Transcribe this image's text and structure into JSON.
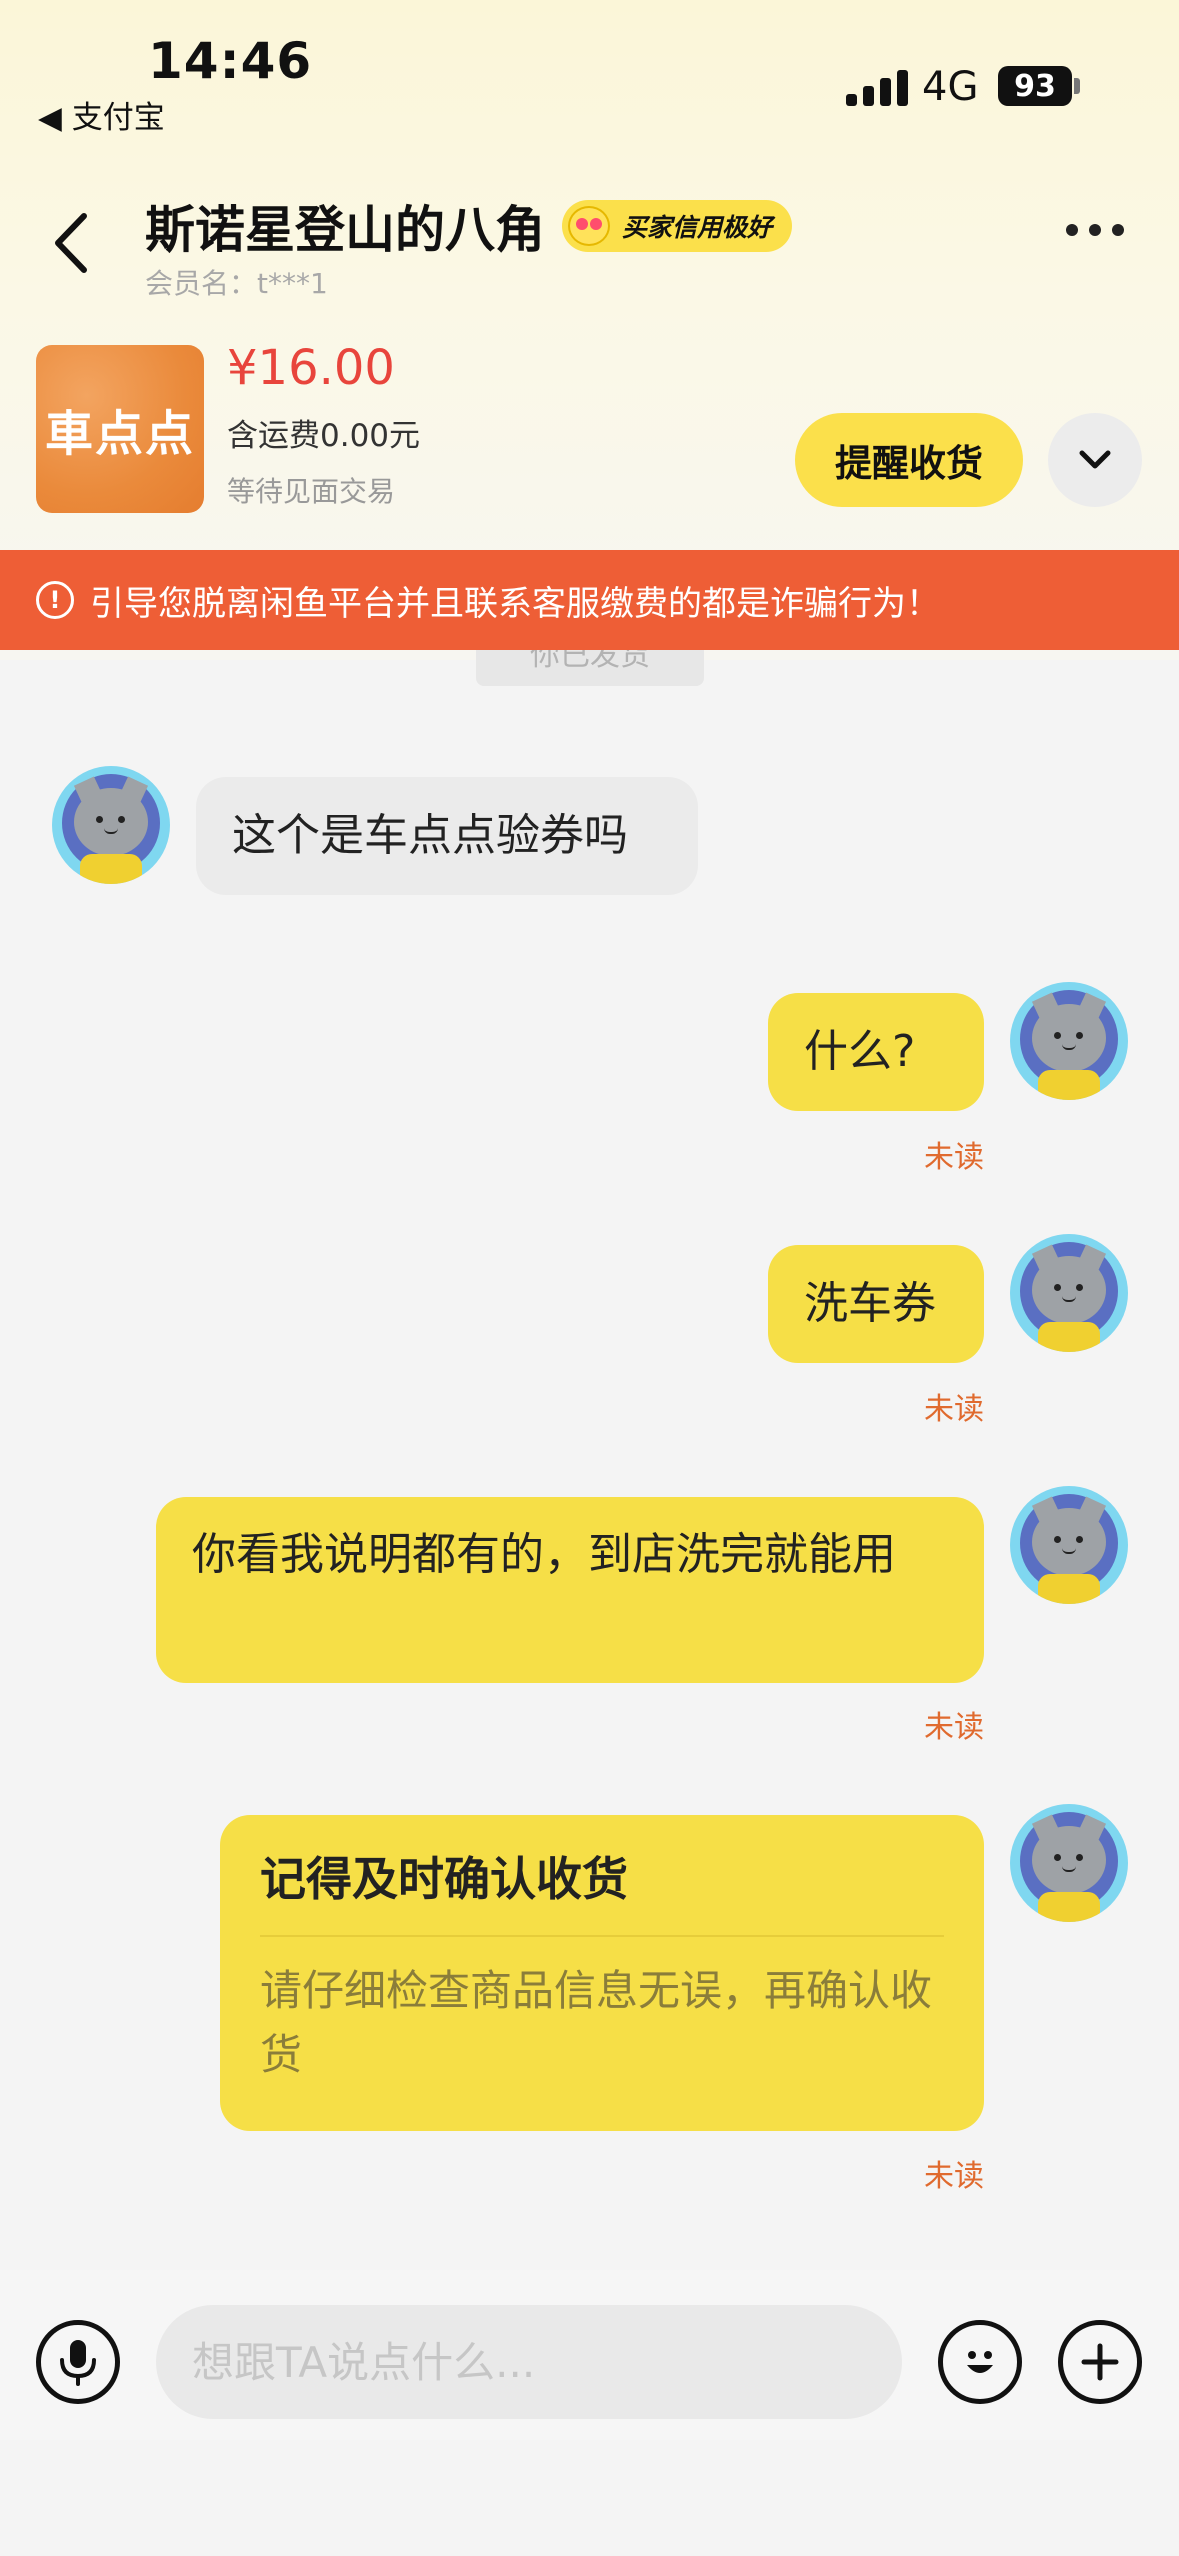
{
  "status_bar": {
    "time": "14:46",
    "back_app": "◀ 支付宝",
    "network": "4G",
    "battery": "93"
  },
  "header": {
    "title": "斯诺星登山的八角",
    "badge": "买家信用极好",
    "member_label": "会员名：t***1"
  },
  "product": {
    "image_label": "車点点",
    "price": "¥16.00",
    "shipping": "含运费0.00元",
    "status": "等待见面交易",
    "remind_button": "提醒收货"
  },
  "warning": {
    "text": "引导您脱离闲鱼平台并且联系客服缴费的都是诈骗行为！"
  },
  "system_notice": "你已发货",
  "messages": [
    {
      "side": "left",
      "text": "这个是车点点验券吗"
    },
    {
      "side": "right",
      "text": "什么?",
      "status": "未读"
    },
    {
      "side": "right",
      "text": "洗车券",
      "status": "未读"
    },
    {
      "side": "right",
      "text": "你看我说明都有的，到店洗完就能用",
      "status": "未读"
    },
    {
      "side": "right",
      "card_title": "记得及时确认收货",
      "card_body": "请仔细检查商品信息无误，再确认收货",
      "status": "未读"
    }
  ],
  "input": {
    "placeholder": "想跟TA说点什么..."
  },
  "icons": [
    "back-icon",
    "more-icon",
    "chevron-down-icon",
    "warning-icon",
    "mic-icon",
    "emoji-icon",
    "plus-icon"
  ],
  "colors": {
    "accent_yellow": "#fbe04b",
    "bubble_yellow": "#f6df47",
    "warning_red": "#ee5e36",
    "price_red": "#e8453c",
    "unread": "#e06a2e"
  }
}
